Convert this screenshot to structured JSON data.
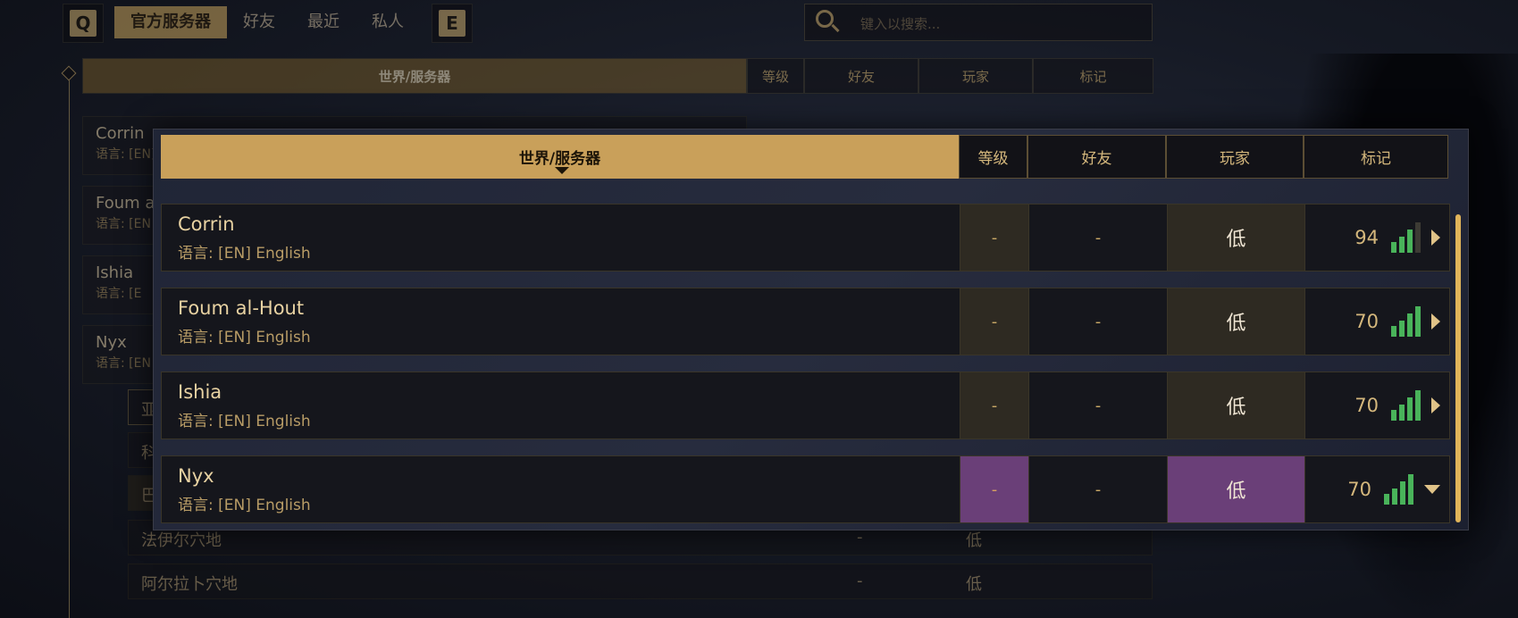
{
  "background": {
    "hotkey_left": "Q",
    "hotkey_right": "E",
    "tabs": [
      {
        "label": "官方服务器",
        "active": true
      },
      {
        "label": "好友",
        "active": false
      },
      {
        "label": "最近",
        "active": false
      },
      {
        "label": "私人",
        "active": false
      }
    ],
    "search_placeholder": "键入以搜索...",
    "header": {
      "world": "世界/服务器",
      "level": "等级",
      "friends": "好友",
      "players": "玩家",
      "tags": "标记"
    },
    "rows": [
      {
        "name": "Corrin",
        "lang": "语言: [EN]"
      },
      {
        "name": "Foum a",
        "lang": "语言: [EN"
      },
      {
        "name": "Ishia",
        "lang": "语言: [E"
      },
      {
        "name": "Nyx",
        "lang": "语言: [EN"
      }
    ],
    "subrows": [
      {
        "name": "亚"
      },
      {
        "name": "科"
      },
      {
        "name": "巴"
      },
      {
        "name": "法伊尔穴地",
        "dash": "-",
        "level": "低"
      },
      {
        "name": "阿尔拉卜穴地",
        "dash": "-",
        "level": "低"
      }
    ]
  },
  "panel": {
    "header": {
      "world": "世界/服务器",
      "level": "等级",
      "friends": "好友",
      "players": "玩家",
      "tags": "标记"
    },
    "rows": [
      {
        "name": "Corrin",
        "lang": "语言: [EN] English",
        "level": "-",
        "friends": "-",
        "players": "低",
        "ping": "94",
        "signal_bars": 3,
        "expanded": false
      },
      {
        "name": "Foum al-Hout",
        "lang": "语言: [EN] English",
        "level": "-",
        "friends": "-",
        "players": "低",
        "ping": "70",
        "signal_bars": 4,
        "expanded": false
      },
      {
        "name": "Ishia",
        "lang": "语言: [EN] English",
        "level": "-",
        "friends": "-",
        "players": "低",
        "ping": "70",
        "signal_bars": 4,
        "expanded": false
      },
      {
        "name": "Nyx",
        "lang": "语言: [EN] English",
        "level": "-",
        "friends": "-",
        "players": "低",
        "ping": "70",
        "signal_bars": 4,
        "expanded": true
      }
    ]
  },
  "colors": {
    "accent_gold": "#c9a05a",
    "selected_purple": "#6a3f78",
    "signal_green": "#49b35a"
  }
}
